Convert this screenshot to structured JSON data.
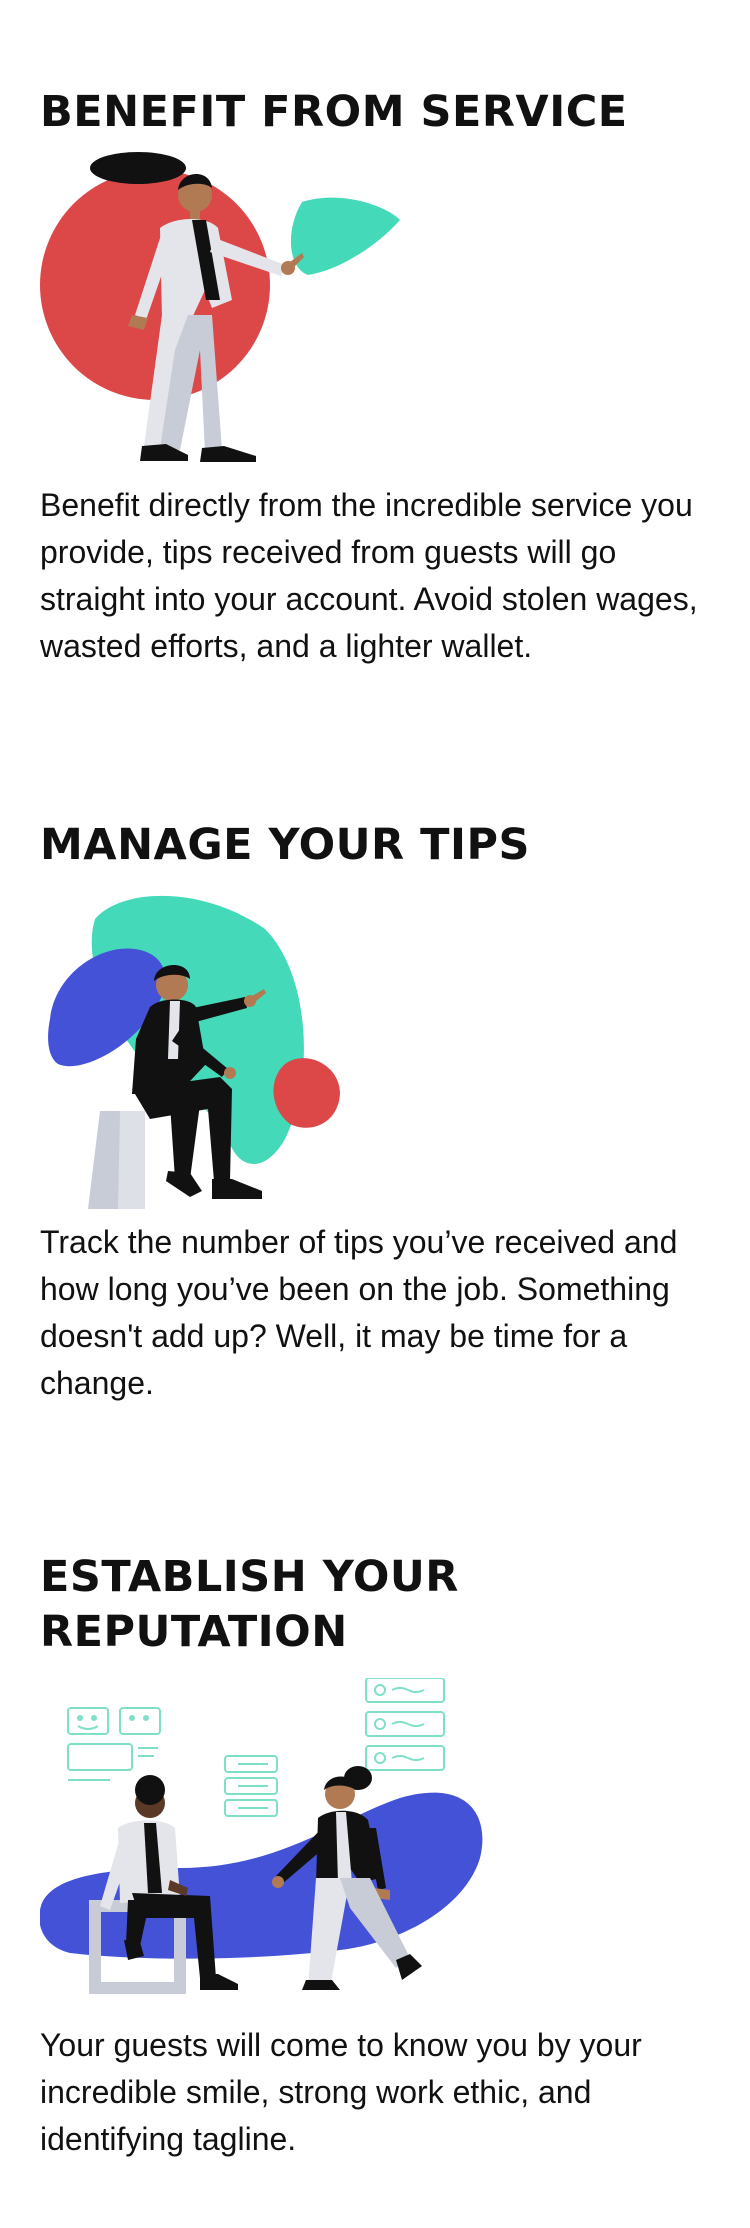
{
  "sections": [
    {
      "title": "BENEFIT FROM SERVICE",
      "body": "Benefit directly from the incredible service you provide, tips received from guests will go straight into your account. Avoid stolen wages, wasted efforts, and a lighter wallet.",
      "illustration": "person-pointing-illustration"
    },
    {
      "title": "MANAGE YOUR TIPS",
      "body": "Track the number of tips you’ve received and how long you’ve been on the job. Something doesn't add up? Well, it may be time for a change.",
      "illustration": "seated-person-pointing-illustration"
    },
    {
      "title": "ESTABLISH YOUR REPUTATION",
      "body": "Your guests will come to know you by your incredible smile, strong work ethic, and identifying tagline.",
      "illustration": "two-people-reviews-illustration"
    }
  ],
  "colors": {
    "red": "#dc4848",
    "teal": "#44d9b8",
    "blue": "#4452d8",
    "light_gray": "#dde0e6",
    "mid_gray": "#c7ccd6",
    "ink": "#111111",
    "skin": "#b27a52"
  }
}
